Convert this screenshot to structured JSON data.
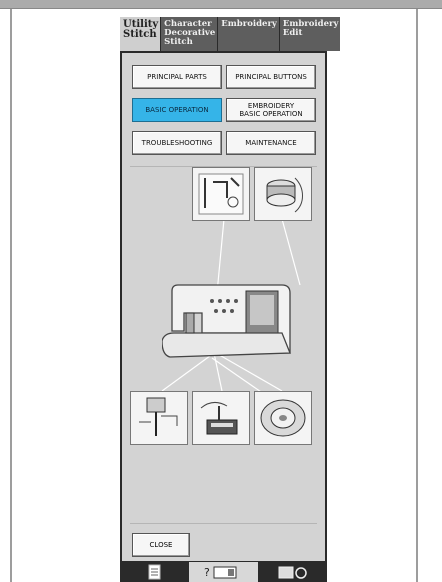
{
  "tabs": [
    {
      "label": "Utility\nStitch",
      "active": true
    },
    {
      "label": "Character\nDecorative\nStitch",
      "active": false
    },
    {
      "label": "Embroidery",
      "active": false
    },
    {
      "label": "Embroidery\nEdit",
      "active": false
    }
  ],
  "menu": {
    "principal_parts": "PRINCIPAL PARTS",
    "principal_buttons": "PRINCIPAL BUTTONS",
    "basic_operation": "BASIC OPERATION",
    "embroidery_basic_operation": "EMBROIDERY\nBASIC OPERATION",
    "troubleshooting": "TROUBLESHOOTING",
    "maintenance": "MAINTENANCE"
  },
  "close_label": "CLOSE",
  "colors": {
    "selected": "#35b4e8",
    "panel": "#d3d3d3"
  },
  "icons": [
    "threading-illustration-icon",
    "bobbin-winding-icon",
    "sewing-machine-icon",
    "needle-icon",
    "presser-foot-icon",
    "bobbin-case-icon",
    "document-icon",
    "machine-help-icon",
    "settings-icon"
  ]
}
